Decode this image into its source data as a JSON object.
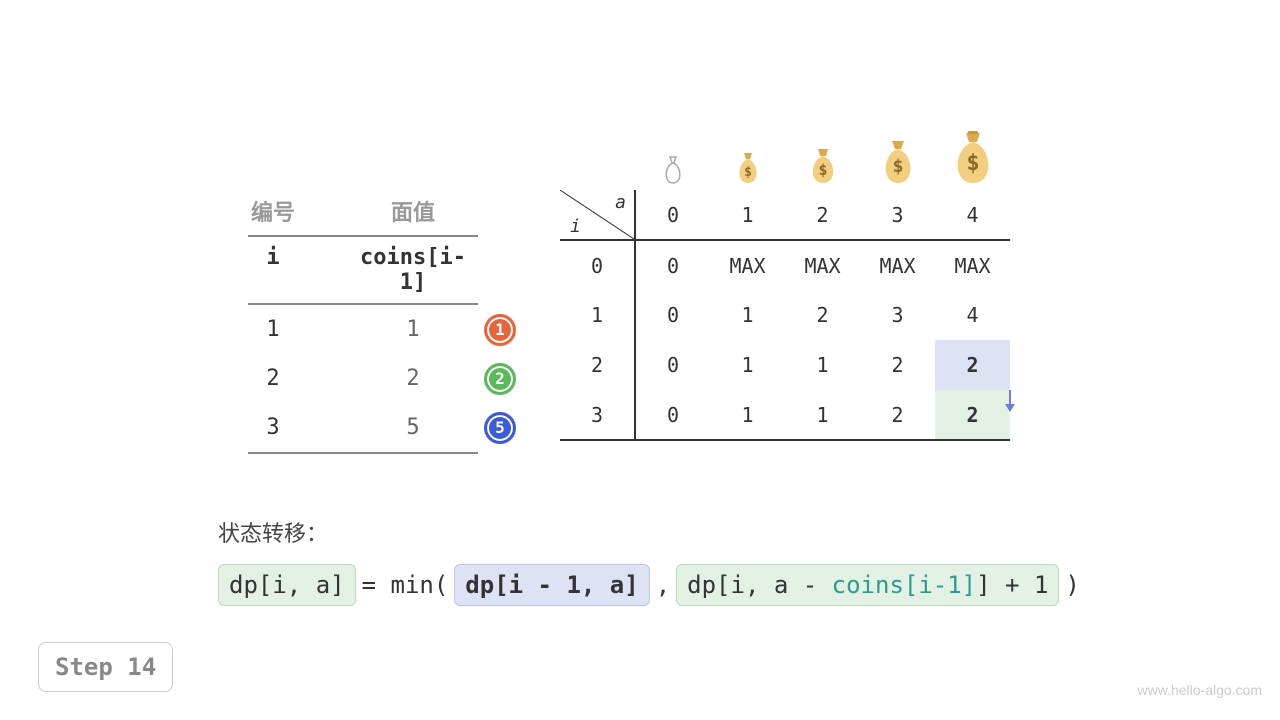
{
  "coin_table": {
    "hdr_i": "编号",
    "hdr_v": "面值",
    "sub_i": "i",
    "sub_v": "coins[i-1]",
    "rows": [
      {
        "i": "1",
        "v": "1",
        "coin_color": "red",
        "coin_label": "1"
      },
      {
        "i": "2",
        "v": "2",
        "coin_color": "green",
        "coin_label": "2"
      },
      {
        "i": "3",
        "v": "5",
        "coin_color": "blue",
        "coin_label": "5"
      }
    ]
  },
  "dp": {
    "corner_i": "i",
    "corner_a": "a",
    "cols": [
      "0",
      "1",
      "2",
      "3",
      "4"
    ],
    "rows": [
      {
        "i": "0",
        "cells": [
          "0",
          "MAX",
          "MAX",
          "MAX",
          "MAX"
        ]
      },
      {
        "i": "1",
        "cells": [
          "0",
          "1",
          "2",
          "3",
          "4"
        ]
      },
      {
        "i": "2",
        "cells": [
          "0",
          "1",
          "1",
          "2",
          "2"
        ]
      },
      {
        "i": "3",
        "cells": [
          "0",
          "1",
          "1",
          "2",
          "2"
        ]
      }
    ],
    "highlight_blue": {
      "row": 2,
      "col": 4
    },
    "highlight_green": {
      "row": 3,
      "col": 4
    }
  },
  "state_label": "状态转移：",
  "equation": {
    "lhs": "dp[i, a]",
    "eq": " = min( ",
    "term1": "dp[i - 1, a]",
    "sep": " , ",
    "term2_pre": "dp[i, a - ",
    "term2_teal": "coins[i-1]",
    "term2_post": "] + 1",
    "close": " )"
  },
  "step": "Step 14",
  "watermark": "www.hello-algo.com",
  "chart_data": {
    "type": "table",
    "title": "Coin change DP table (min coins to make amount a using first i coin types)",
    "coins": [
      1,
      2,
      5
    ],
    "columns_a": [
      0,
      1,
      2,
      3,
      4
    ],
    "rows_i": [
      0,
      1,
      2,
      3
    ],
    "dp": [
      [
        0,
        "MAX",
        "MAX",
        "MAX",
        "MAX"
      ],
      [
        0,
        1,
        2,
        3,
        4
      ],
      [
        0,
        1,
        1,
        2,
        2
      ],
      [
        0,
        1,
        1,
        2,
        2
      ]
    ],
    "current_step": 14,
    "transition_from": {
      "i": 2,
      "a": 4,
      "value": 2
    },
    "transition_to": {
      "i": 3,
      "a": 4,
      "value": 2
    },
    "recurrence": "dp[i,a] = min(dp[i-1,a], dp[i, a - coins[i-1]] + 1)"
  }
}
